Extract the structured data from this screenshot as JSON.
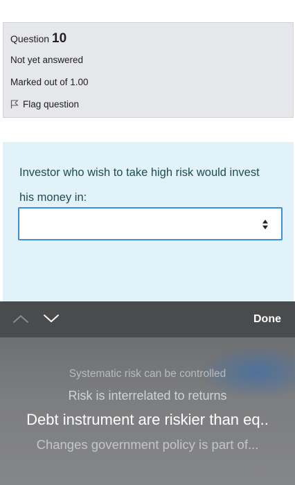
{
  "question_info": {
    "question_label": "Question",
    "question_number": "10",
    "state": "Not yet answered",
    "grade": "Marked out of 1.00",
    "flag_label": "Flag question"
  },
  "question": {
    "prompt": "Investor who wish to take high risk would invest his money in:",
    "selected_value": ""
  },
  "toolbar": {
    "done_label": "Done"
  },
  "picker": {
    "options": [
      "Systematic risk can be controlled",
      "Risk is interrelated to returns",
      "Debt instrument are riskier than eq..",
      "Changes government policy is part of..."
    ],
    "selected_index": 2
  },
  "colors": {
    "info_bg": "#e6e7ea",
    "question_bg": "#e1f2f8",
    "select_border": "#3a8ed6",
    "toolbar_bg": "#4a4b4d"
  }
}
